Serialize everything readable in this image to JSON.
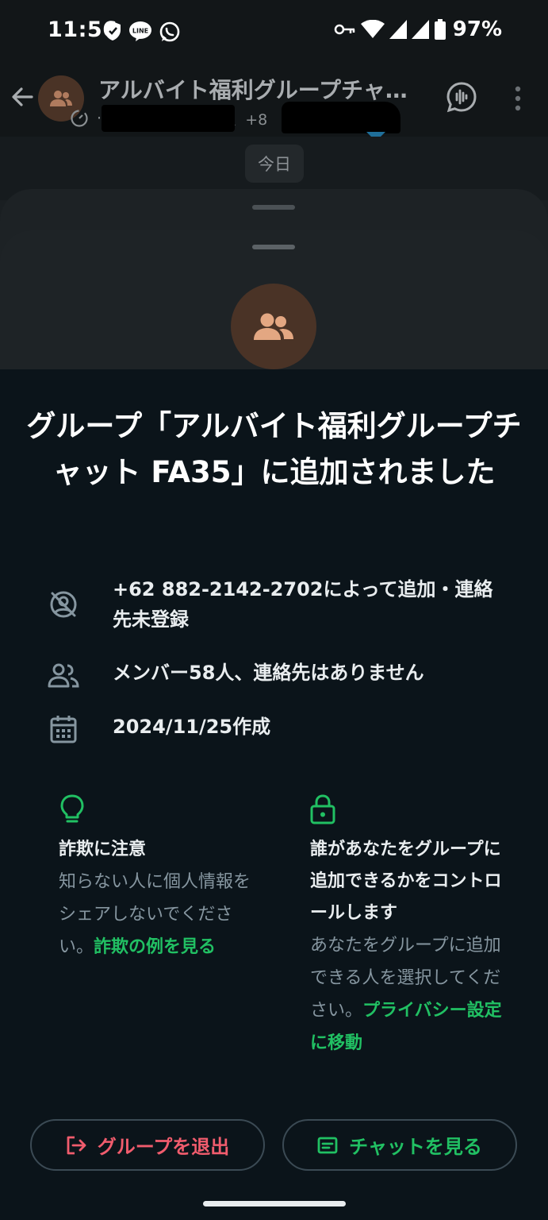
{
  "status_bar": {
    "time": "11:56",
    "battery": "97%",
    "icons": [
      "shield-icon",
      "line-app-icon",
      "whatsapp-icon",
      "vpn-key-icon",
      "wifi-icon",
      "signal-icon",
      "signal-icon-2",
      "battery-icon"
    ]
  },
  "chat_header": {
    "title": "アルバイト福利グループチャ…",
    "subtitle_fragments": [
      "·",
      "28、+8",
      "…"
    ]
  },
  "chat": {
    "date_chip": "今日"
  },
  "sheet": {
    "title": "グループ「アルバイト福利グループチャット FA35」に追加されました",
    "info": {
      "added_by": "+62 882-2142-2702によって追加・連絡先未登録",
      "members": "メンバー58人、連絡先はありません",
      "created": "2024/11/25作成"
    },
    "tips": {
      "scam": {
        "heading": "詐欺に注意",
        "body": "知らない人に個人情報をシェアしないでください。",
        "link": "詐欺の例を見る"
      },
      "privacy": {
        "heading": "誰があなたをグループに追加できるかをコントロールします",
        "body": "あなたをグループに追加できる人を選択してください。",
        "link": "プライバシー設定に移動"
      }
    },
    "buttons": {
      "exit": "グループを退出",
      "view_chat": "チャットを見る"
    }
  },
  "colors": {
    "accent_green": "#21c063",
    "danger_red": "#f15c6d",
    "background": "#0b141a",
    "muted_text": "#8696a0",
    "avatar_bg": "#4a3326",
    "avatar_fg": "#e3a782"
  }
}
